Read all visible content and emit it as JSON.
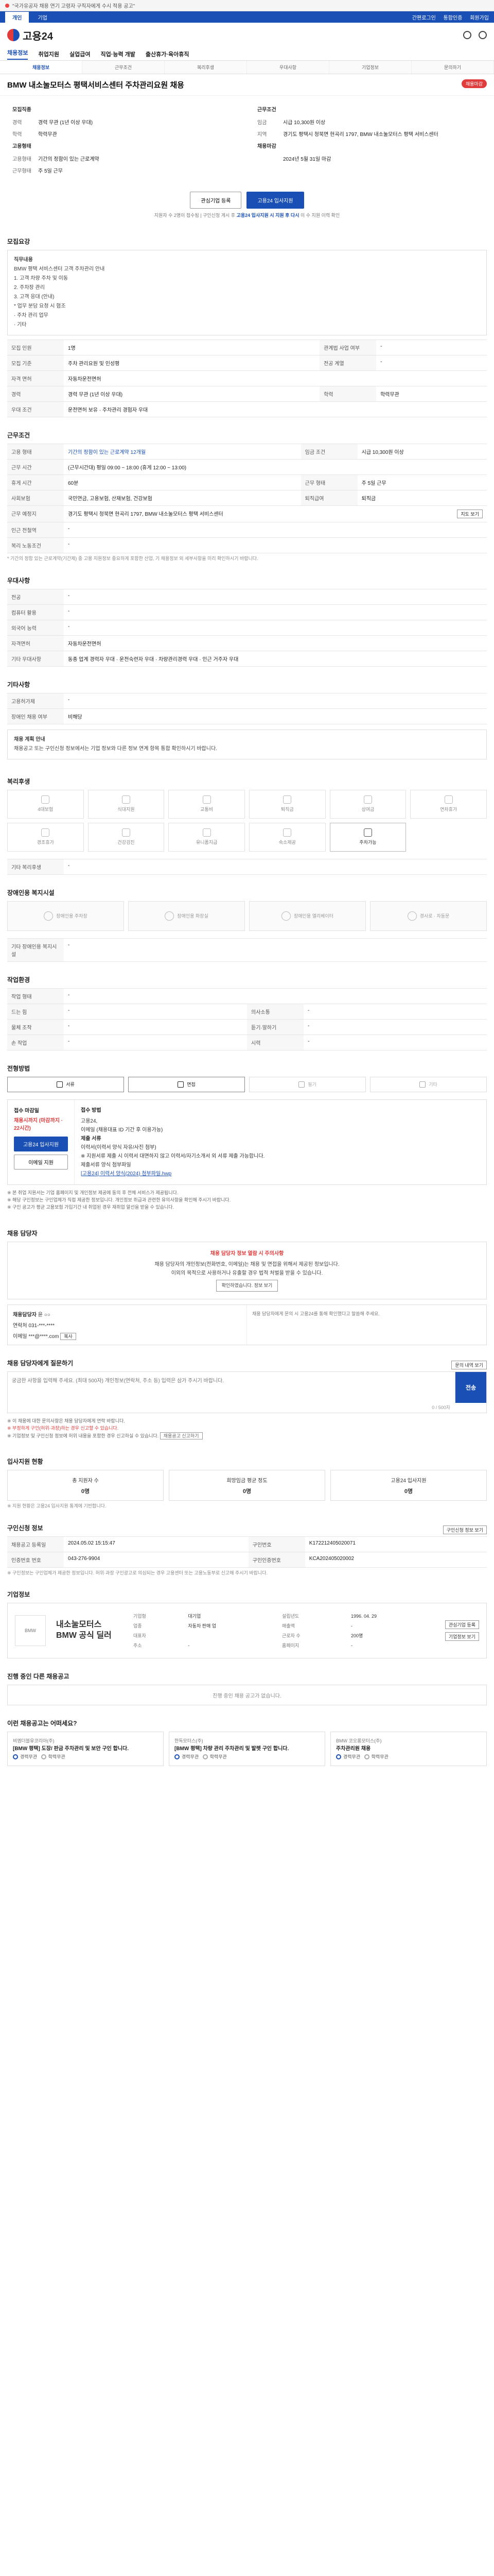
{
  "notice": "\"국가유공자 채용 연기 고령자 구직자에게 수시 적용 공고\"",
  "utilbar": {
    "tabs": [
      "개인",
      "기업"
    ],
    "links": [
      "간편로그인",
      "통합인증",
      "회원가입"
    ]
  },
  "header": {
    "logo": "고용24"
  },
  "gnb": [
    "채용정보",
    "취업지원",
    "실업급여",
    "직업·능력 개발",
    "출산휴가·육아휴직"
  ],
  "subnav": [
    "채용정보",
    "근무조건",
    "복리후생",
    "우대사항",
    "기업정보",
    "문의하기"
  ],
  "job": {
    "title": "BMW 내소눌모터스 평택서비스센터 주차관리요원 채용",
    "badge": "채용마감",
    "summary_left_heading": "모집직종",
    "summary_left": [
      {
        "k": "경력",
        "v": "경력 무관 (1년 이상 우대)"
      },
      {
        "k": "학력",
        "v": "학력무관"
      }
    ],
    "summary_right_heading": "근무조건",
    "summary_right": [
      {
        "k": "임금",
        "v": "시급 10,300원 이상"
      },
      {
        "k": "지역",
        "v": "경기도 평택시 청북면 현곡리 1797, BMW 내소눌모터스 평택 서비스센터"
      }
    ],
    "summary_left2_heading": "고용형태",
    "summary_left2": [
      {
        "k": "고용형태",
        "v": "기간의 정함이 있는 근로계약"
      },
      {
        "k": "근무형태",
        "v": "주 5일 근무"
      }
    ],
    "summary_right2_heading": "채용마감",
    "summary_right2": [
      {
        "k": "",
        "v": "2024년 5월 31일 마감"
      }
    ],
    "interest_btn": "관심기업 등록",
    "apply_btn": "고용24 입사지원",
    "note_prefix": "지원자 수 2명이 접수됨  |  구인신청 게시 후",
    "note_bold": "고용24 입사지원 시 지원 후 다시",
    "note_suffix": "이 수 지원 이력 확인",
    "apply_note": "고용24 입사지원 시 지원 후 다시 이 수 지원 이력 확인"
  },
  "recruit": {
    "heading": "모집요강",
    "box": [
      "직무내용",
      "BMW 평택 서비스센터 고객 주차관리 안내",
      "",
      "1. 고객 차량 주차 및 이동",
      "2. 주차장 관리",
      "3. 고객 응대 (안내)",
      "* 업무 분담 요청 시 협조",
      "· 주차 관리 업무",
      "· 기타"
    ],
    "rows": [
      {
        "k1": "모집 인원",
        "v1": "1명",
        "k2": "관계법 사업 여부",
        "v2": "-"
      },
      {
        "k1": "모집 기준",
        "v1": "주차 관리요원 및 인성평",
        "k2": "전공 계열",
        "v2": "-"
      },
      {
        "k1": "자격 면허",
        "v1": "자동차운전면허",
        "k2": "",
        "v2": ""
      },
      {
        "k1": "경력",
        "v1": "경력 무관 (1년 이상 우대)",
        "k2": "학력",
        "v2": "학력무관"
      },
      {
        "k1": "우대 조건",
        "v1": "운전면허 보유 · 주차관리 경험자 우대",
        "k2": "",
        "v2": ""
      }
    ]
  },
  "work": {
    "heading": "근무조건",
    "rows": [
      {
        "k1": "고용 형태",
        "v1": "기간의 정함이 있는 근로계약 12개월",
        "k2": "임금 조건",
        "v2": "시급 10,300원 이상"
      },
      {
        "k1": "근무 시간",
        "v1": "(근무시간대) 평일 09:00 ~ 18:00 (휴게 12:00 ~ 13:00)",
        "k2": "",
        "v2": ""
      },
      {
        "k1": "휴게 시간",
        "v1": "60분",
        "k2": "근무 형태",
        "v2": "주 5일 근무"
      },
      {
        "k1": "사회보험",
        "v1": "국민연금, 고용보험, 산재보험, 건강보험",
        "k2": "퇴직급여",
        "v2": "퇴직금"
      },
      {
        "k1": "근무 예정지",
        "v1": "경기도 평택시 청북면 현곡리 1797, BMW 내소눌모터스 평택 서비스센터",
        "k2": "",
        "v2": ""
      },
      {
        "k1": "인근 전철역",
        "v1": "-",
        "k2": "",
        "v2": ""
      },
      {
        "k1": "복리 노동조건",
        "v1": "-",
        "k2": "",
        "v2": ""
      }
    ],
    "map_btn": "지도 보기",
    "footnote": "* 기간의 정함 있는 근로계약(기간제) 중 고용 지원정보 중요하게 포함한 산업, 기 채용정보 외 세부사항을 미리 확인하시기 바랍니다."
  },
  "prefer": {
    "heading": "우대사항",
    "rows": [
      {
        "k": "전공",
        "v": "-"
      },
      {
        "k": "컴퓨터 활용",
        "v": "-"
      },
      {
        "k": "외국어 능력",
        "v": "-"
      },
      {
        "k": "자격면허",
        "v": "자동차운전면허"
      },
      {
        "k": "기타 우대사항",
        "v": "동종 업계 경력자 우대 · 운전숙련자 우대 · 차량관리경력 우대 · 인근 거주자 우대"
      }
    ]
  },
  "other": {
    "heading": "기타사항",
    "rows": [
      {
        "k": "고용허가제",
        "v": "-"
      },
      {
        "k": "장애인 채용 여부",
        "v": "비해당"
      }
    ],
    "notice_title": "채용 계획 안내",
    "notice_text": "채용공고 또는 구인신청 정보에서는 기업 정보와 다른 정보 연계 항목 통합 확인하시기 바랍니다."
  },
  "welfare": {
    "heading": "복리후생",
    "items": [
      {
        "label": "4대보험",
        "on": false
      },
      {
        "label": "식대지원",
        "on": false
      },
      {
        "label": "교통비",
        "on": false
      },
      {
        "label": "퇴직금",
        "on": false
      },
      {
        "label": "상여금",
        "on": false
      },
      {
        "label": "연차휴가",
        "on": false
      },
      {
        "label": "경조휴가",
        "on": false
      },
      {
        "label": "건강검진",
        "on": false
      },
      {
        "label": "유니폼지급",
        "on": false
      },
      {
        "label": "숙소제공",
        "on": false
      },
      {
        "label": "주차가능",
        "on": true
      }
    ],
    "extra_heading": "기타 복리후생",
    "extra": "-"
  },
  "disability": {
    "heading": "장애인용 복지시설",
    "items": [
      "장애인용 주차장",
      "장애인용 화장실",
      "장애인용 엘리베이터",
      "경사로 · 자동문"
    ],
    "extra_heading": "기타 장애인용 복지시설",
    "extra": "-"
  },
  "env": {
    "heading": "작업환경",
    "rows": [
      {
        "k1": "작업 형태",
        "v1": "-",
        "k2": "",
        "v2": ""
      },
      {
        "k1": "드는 힘",
        "v1": "-",
        "k2": "의사소통",
        "v2": "-"
      },
      {
        "k1": "물체 조작",
        "v1": "-",
        "k2": "듣기·말하기",
        "v2": "-"
      },
      {
        "k1": "손 작업",
        "v1": "-",
        "k2": "시력",
        "v2": "-"
      }
    ]
  },
  "method": {
    "heading": "전형방법",
    "chips": [
      {
        "label": "서류",
        "on": true
      },
      {
        "label": "면접",
        "on": true
      },
      {
        "label": "필기",
        "on": false
      },
      {
        "label": "기타",
        "on": false
      }
    ],
    "box_label": "접수 마감일",
    "box_deadline": "채용시까지 (마감까지 · 22시간)",
    "apply_btn": "고용24 입사지원",
    "email_btn": "이메일 지원",
    "right_title": "접수 방법",
    "right_lines": [
      "고용24,",
      "이메일 (채용대표 ID 기간 후 이용가능)",
      "",
      "제출 서류",
      "이력서(이력서 양식 자유/사진 첨부)",
      "※ 지원서류 제출 시 이력서 대면하지 않고 이력서/자기소개서 외 서류 제출 가능합니다.",
      "제출서류 양식 첨부파일"
    ],
    "link": "[고용24] 이력서 양식(2024) 첨부파일.hwp",
    "bullets": [
      "※ 본 취업 지원서는 기업 홈페이지 및 개인정보 제공에 동의 후 전체 서비스가 제공됩니다.",
      "※ 해당 구인정보는 구인업체가 직접 제공한 정보입니다. 개인정보 취급과 관련한 유의사항을 확인해 주시기 바랍니다.",
      "※ 구인 공고가 평균 고용보험 가입기간 내 취업된 경우 재취업 알선을 받을 수 있습니다."
    ]
  },
  "manager": {
    "heading": "채용 담당자",
    "warn_title": "채용 담당자 정보 열람 시 주의사항",
    "warn_lines": [
      "채용 담당자의 개인정보(전화번호, 이메일)는 채용 및 면접을 위해서 제공된 정보입니다.",
      "이외의 목적으로 사용하거나 유출할 경우 법적 처벌을 받을 수 있습니다."
    ],
    "warn_btn": "확인하였습니다. 정보 보기",
    "contact_name_label": "채용담당자",
    "contact_name": "윤 ○○",
    "contact_phone_label": "연락처",
    "contact_phone": "031-***-****",
    "contact_right_label": "이메일",
    "contact_right": "***@****.com",
    "contact_btn": "복사",
    "contact_note": "채용 담당자에게 문의 시 고용24를 통해 확인했다고 말씀해 주세요."
  },
  "inquiry": {
    "heading": "채용 담당자에게 질문하기",
    "link": "문의 내역 보기",
    "placeholder": "궁금한 사항을 입력해 주세요. (최대 500자) 개인정보(연락처, 주소 등) 입력은 삼가 주시기 바랍니다.",
    "counter": "0 / 500자",
    "send": "전송",
    "bullets": [
      "※ 이 채용에 대한 문의사항은 채용 담당자에게 연락 바랍니다.",
      "※ 부정하게 구인(허위·과장)하는 경우 신고할 수 있습니다.",
      "※ 기업정보 및 구인신청 정보에 허위 내용을 포함한 경우 신고하실 수 있습니다."
    ],
    "report_btn": "채용공고 신고하기"
  },
  "stats": {
    "heading": "입사지원 현황",
    "items": [
      {
        "label": "총 지원자 수",
        "value": "0명"
      },
      {
        "label": "희망임금 평균 정도",
        "value": "0명"
      },
      {
        "label": "고용24 입사지원",
        "value": "0명"
      }
    ],
    "note": "※ 지원 현황은 고용24 입사지원 통계에 기반합니다."
  },
  "registry": {
    "heading": "구인신청 정보",
    "btn": "구인신청 정보 보기",
    "rows": [
      {
        "k1": "채용공고 등록일",
        "v1": "2024.05.02 15:15:47",
        "k2": "구인번호",
        "v2": "K172212405020071"
      },
      {
        "k1": "인증번호 번호",
        "v1": "043-276-9904",
        "k2": "구인인증번호",
        "v2": "KCA202405020002"
      }
    ],
    "footnote": "※ 구인정보는 구인업체가 제공한 정보입니다. 허위·과장 구인광고로 의심되는 경우 고용센터 또는 고용노동부로 신고해 주시기 바랍니다."
  },
  "company": {
    "heading": "기업정보",
    "logo_alt": "BMW",
    "name": "내소눌모터스 BMW 공식 딜러",
    "rows": [
      {
        "k1": "기업형",
        "v1": "대기업",
        "k2": "설립년도",
        "v2": "1996. 04. 29"
      },
      {
        "k1": "업종",
        "v1": "자동차 판매 업",
        "k2": "매출액",
        "v2": "-"
      },
      {
        "k1": "대표자",
        "v1": "",
        "k2": "근로자 수",
        "v2": "200명"
      },
      {
        "k1": "주소",
        "v1": "-",
        "k2": "홈페이지",
        "v2": "-"
      }
    ],
    "btn1": "관심기업 등록",
    "btn2": "기업정보 보기"
  },
  "others": {
    "heading": "진행 중인 다른 채용공고",
    "empty": "진행 중인 채용 공고가 없습니다."
  },
  "recommend": {
    "heading": "이런 채용공고는 어떠세요?",
    "items": [
      {
        "co": "비엠더블유코리아(주)",
        "t": "[BMW 평택] 도장/ 판금 주차관리 및 보안 구인 합니다.",
        "m1": "경력무관",
        "m2": "학력무관"
      },
      {
        "co": "한독모터스(주)",
        "t": "[BMW 평택] 차량 관리 주차관리 및 발렛 구인 합니다.",
        "m1": "경력무관",
        "m2": "학력무관"
      },
      {
        "co": "BMW 코오롱모터스(주)",
        "t": "주차관리원 채용",
        "m1": "경력무관",
        "m2": "학력무관"
      }
    ]
  }
}
